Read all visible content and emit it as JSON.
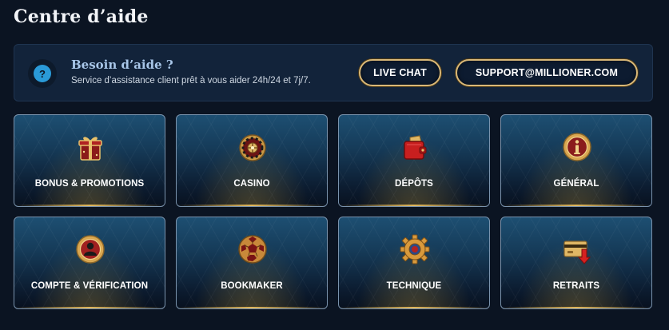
{
  "page": {
    "title": "Centre d’aide"
  },
  "help": {
    "icon": "question-icon",
    "icon_glyph": "?",
    "title": "Besoin d’aide ?",
    "subtitle": "Service d’assistance client prêt à vous aider 24h/24 et 7j/7.",
    "live_chat_label": "LIVE CHAT",
    "email_label": "SUPPORT@MILLIONER.COM"
  },
  "categories": [
    {
      "label": "BONUS & PROMOTIONS",
      "icon": "gift-icon"
    },
    {
      "label": "CASINO",
      "icon": "roulette-icon"
    },
    {
      "label": "DÉPÔTS",
      "icon": "wallet-icon"
    },
    {
      "label": "GÉNÉRAL",
      "icon": "info-icon"
    },
    {
      "label": "COMPTE & VÉRIFICATION",
      "icon": "user-icon"
    },
    {
      "label": "BOOKMAKER",
      "icon": "soccer-ball-icon"
    },
    {
      "label": "TECHNIQUE",
      "icon": "gear-icon"
    },
    {
      "label": "RETRAITS",
      "icon": "card-withdraw-icon"
    }
  ],
  "colors": {
    "background": "#0b1422",
    "banner": "#12233a",
    "accent_gold": "#d9b878",
    "help_blue": "#2a9ad8"
  }
}
